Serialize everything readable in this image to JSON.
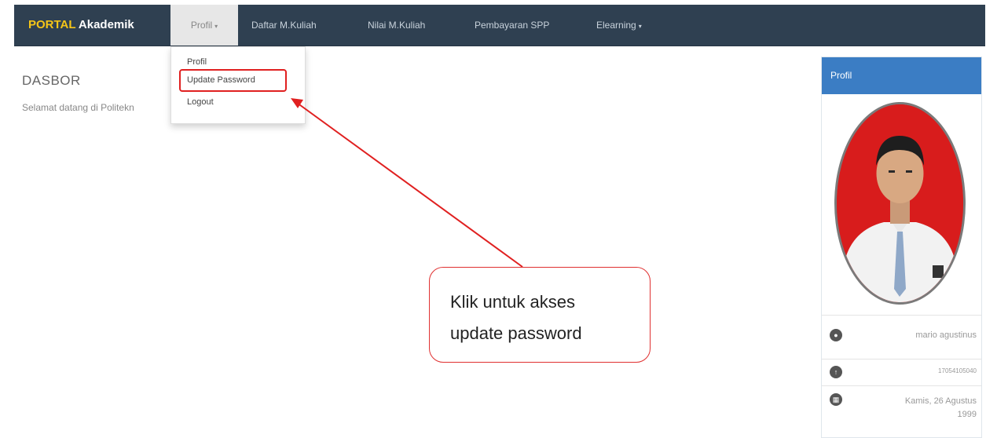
{
  "navbar": {
    "brand_part1": "PORTAL",
    "brand_part2": " Akademik",
    "items": [
      {
        "label": "Profil",
        "caret": "▾"
      },
      {
        "label": "Daftar M.Kuliah"
      },
      {
        "label": "Nilai M.Kuliah"
      },
      {
        "label": "Pembayaran SPP"
      },
      {
        "label": "Elearning",
        "caret": "▾"
      }
    ]
  },
  "dropdown": {
    "items": [
      "Profil",
      "Update Password",
      "Logout"
    ]
  },
  "main": {
    "title": "DASBOR",
    "welcome": "Selamat datang di Politekn"
  },
  "profile_panel": {
    "heading": "Profil",
    "name": "mario agustinus",
    "id": "17054105040",
    "birth_line1": "Kamis, 26 Agustus",
    "birth_line2": "1999"
  },
  "annotation": {
    "line1": "Klik untuk akses",
    "line2": "update password",
    "color": "#e02020"
  },
  "colors": {
    "navbar": "#2f4051",
    "panel_heading": "#3b7dc4",
    "photo_bg": "#d81c1c"
  }
}
